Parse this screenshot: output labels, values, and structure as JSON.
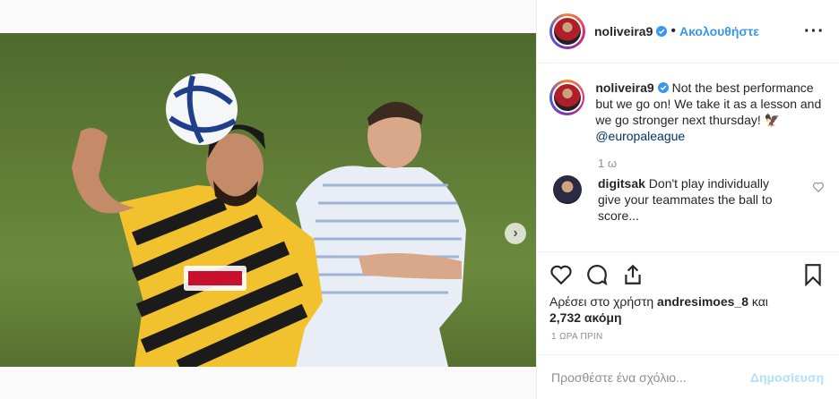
{
  "post": {
    "username": "noliveira9",
    "follow_label": "Ακολουθήστε",
    "separator": "•",
    "more_icon": "more-options-icon",
    "caption_text": "Not the best performance but we go on! We take it as a lesson and we go stronger next thursday! ",
    "caption_emoji": "🦅",
    "caption_mention": "@europaleague",
    "caption_time": "1 ω"
  },
  "comment": {
    "username": "digitsak",
    "text": "Don't play individually give your teammates the ball to score..."
  },
  "likes": {
    "prefix": "Αρέσει στο χρήστη",
    "user": "andresimoes_8",
    "middle": "και",
    "count": "2,732 ακόμη"
  },
  "timestamp": "1 ΩΡΑ ΠΡΙΝ",
  "add_comment": {
    "placeholder": "Προσθέστε ένα σχόλιο...",
    "post_label": "Δημοσίευση"
  },
  "carousel": {
    "next_icon": "chevron-right-icon",
    "total_slides": 2,
    "active_slide": 1
  },
  "colors": {
    "accent": "#3897f0",
    "post_disabled": "#b2dffc",
    "muted": "#8e8e8e"
  }
}
